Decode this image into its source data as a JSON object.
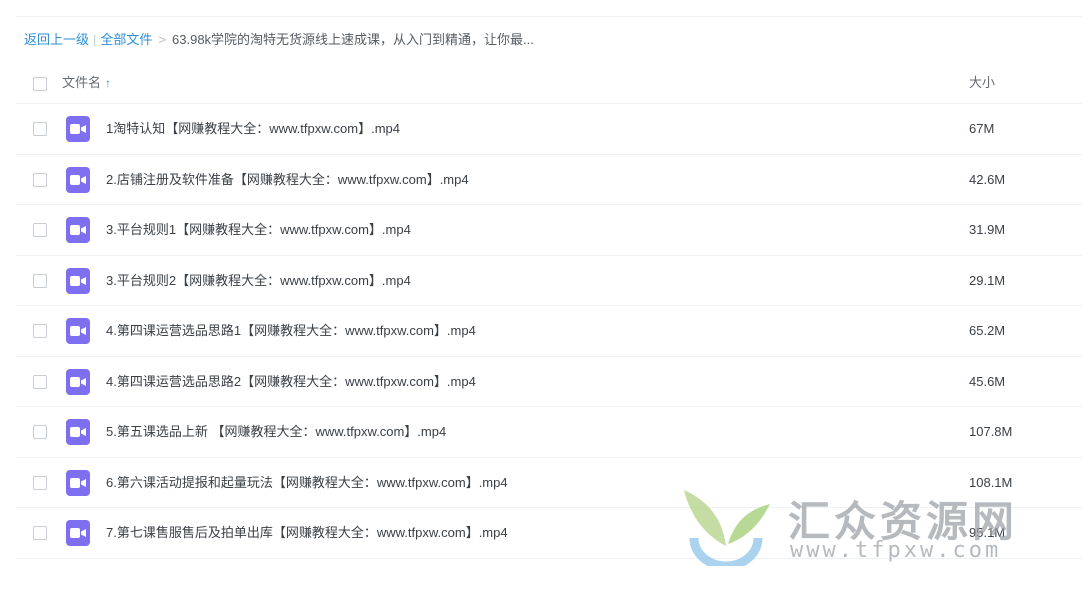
{
  "breadcrumb": {
    "back": "返回上一级",
    "separator": "|",
    "all_files": "全部文件",
    "chevron": ">",
    "current": "63.98k学院的淘特无货源线上速成课，从入门到精通，让你最..."
  },
  "table": {
    "columns": {
      "name": "文件名",
      "size": "大小"
    },
    "sort_icon": "arrow-up-icon",
    "rows": [
      {
        "name": "1淘特认知【网赚教程大全：www.tfpxw.com】.mp4",
        "size": "67M",
        "icon": "video-file-icon"
      },
      {
        "name": "2.店铺注册及软件准备【网赚教程大全：www.tfpxw.com】.mp4",
        "size": "42.6M",
        "icon": "video-file-icon"
      },
      {
        "name": "3.平台规则1【网赚教程大全：www.tfpxw.com】.mp4",
        "size": "31.9M",
        "icon": "video-file-icon"
      },
      {
        "name": "3.平台规则2【网赚教程大全：www.tfpxw.com】.mp4",
        "size": "29.1M",
        "icon": "video-file-icon"
      },
      {
        "name": "4.第四课运营选品思路1【网赚教程大全：www.tfpxw.com】.mp4",
        "size": "65.2M",
        "icon": "video-file-icon"
      },
      {
        "name": "4.第四课运营选品思路2【网赚教程大全：www.tfpxw.com】.mp4",
        "size": "45.6M",
        "icon": "video-file-icon"
      },
      {
        "name": "5.第五课选品上新 【网赚教程大全：www.tfpxw.com】.mp4",
        "size": "107.8M",
        "icon": "video-file-icon"
      },
      {
        "name": "6.第六课活动提报和起量玩法【网赚教程大全：www.tfpxw.com】.mp4",
        "size": "108.1M",
        "icon": "video-file-icon"
      },
      {
        "name": "7.第七课售服售后及拍单出库【网赚教程大全：www.tfpxw.com】.mp4",
        "size": "95.1M",
        "icon": "video-file-icon"
      }
    ]
  },
  "watermark": {
    "title": "汇众资源网",
    "url": "www.tfpxw.com"
  },
  "colors": {
    "link": "#2e8ed6",
    "video_icon": "#7d6ff0",
    "row_border": "#eef1f4"
  }
}
